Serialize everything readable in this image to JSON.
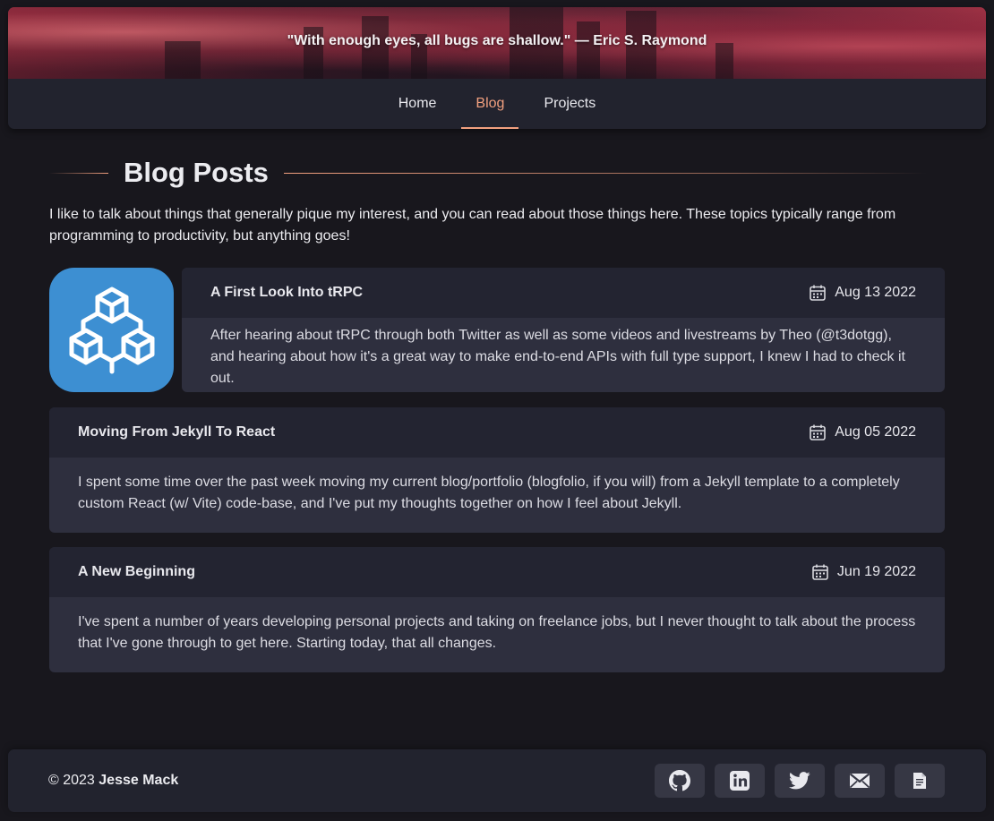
{
  "header": {
    "quote": "\"With enough eyes, all bugs are shallow.\" — Eric S. Raymond",
    "nav": [
      {
        "label": "Home",
        "active": false
      },
      {
        "label": "Blog",
        "active": true
      },
      {
        "label": "Projects",
        "active": false
      }
    ]
  },
  "main": {
    "heading": "Blog Posts",
    "intro": "I like to talk about things that generally pique my interest, and you can read about those things here. These topics typically range from programming to productivity, but anything goes!",
    "posts": [
      {
        "title": "A First Look Into tRPC",
        "date": "Aug 13 2022",
        "excerpt": "After hearing about tRPC through both Twitter as well as some videos and livestreams by Theo (@t3dotgg), and hearing about how it's a great way to make end-to-end APIs with full type support, I knew I had to check it out.",
        "thumbnail_icon": "trpc-logo-icon"
      },
      {
        "title": "Moving From Jekyll To React",
        "date": "Aug 05 2022",
        "excerpt": "I spent some time over the past week moving my current blog/portfolio (blogfolio, if you will) from a Jekyll template to a completely custom React (w/ Vite) code-base, and I've put my thoughts together on how I feel about Jekyll."
      },
      {
        "title": "A New Beginning",
        "date": "Jun 19 2022",
        "excerpt": "I've spent a number of years developing personal projects and taking on freelance jobs, but I never thought to talk about the process that I've gone through to get here. Starting today, that all changes."
      }
    ]
  },
  "footer": {
    "copyright_prefix": "© 2023",
    "author": "Jesse Mack",
    "socials": [
      "github-icon",
      "linkedin-icon",
      "twitter-icon",
      "mail-icon",
      "resume-icon"
    ]
  },
  "colors": {
    "accent": "#f2a07f",
    "background": "#18171d",
    "card": "#2e2f3e",
    "card_header": "#232431",
    "trpc_blue": "#3d8fd2"
  }
}
